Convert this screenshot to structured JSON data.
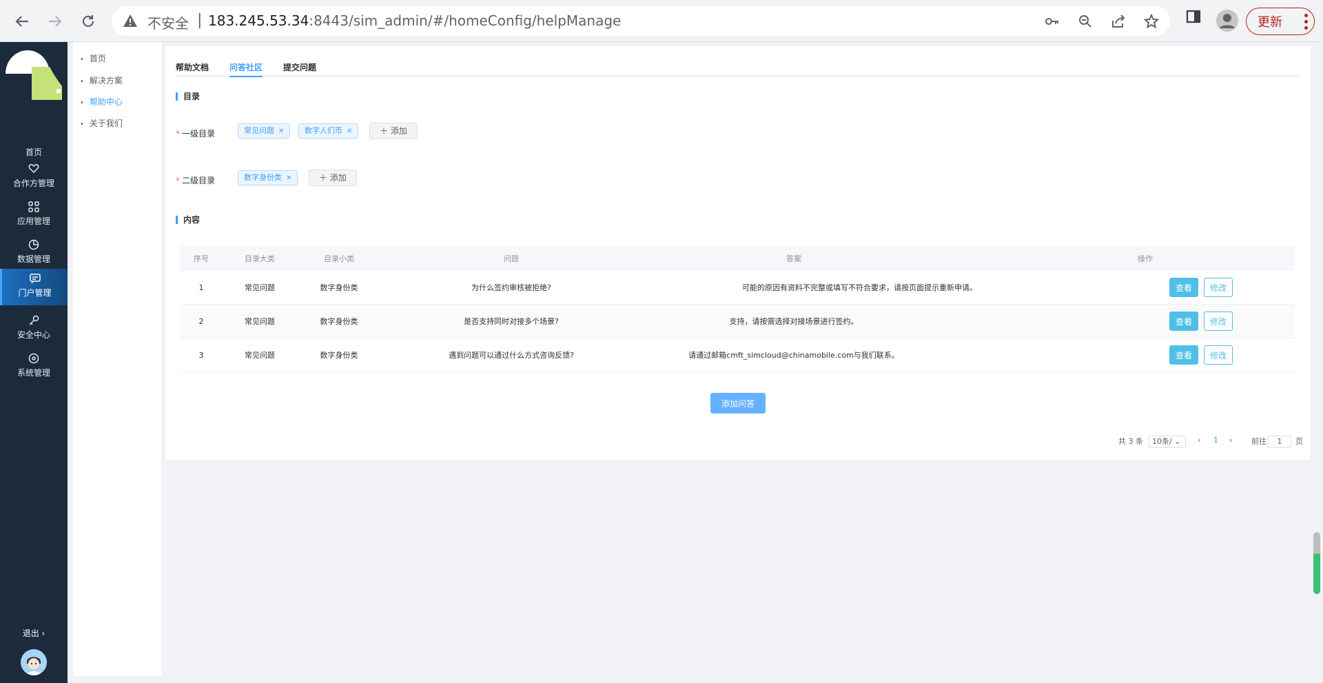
{
  "browser": {
    "insecure_label": "不安全",
    "url_host": "183.245.53.34",
    "url_rest": ":8443/sim_admin/#/homeConfig/helpManage",
    "update_label": "更新"
  },
  "sidebar": {
    "items": [
      {
        "label": "首页",
        "icon": "home-icon"
      },
      {
        "label": "合作方管理",
        "icon": "handshake-icon"
      },
      {
        "label": "应用管理",
        "icon": "grid-icon"
      },
      {
        "label": "数据管理",
        "icon": "pie-chart-icon"
      },
      {
        "label": "门户管理",
        "icon": "message-icon"
      },
      {
        "label": "安全中心",
        "icon": "key-icon"
      },
      {
        "label": "系统管理",
        "icon": "settings-icon"
      }
    ],
    "logout": "退出 ›"
  },
  "subnav": {
    "items": [
      "首页",
      "解决方案",
      "帮助中心",
      "关于我们"
    ]
  },
  "tabs": [
    "帮助文档",
    "问答社区",
    "提交问题"
  ],
  "sections": {
    "catalog": "目录",
    "content": "内容"
  },
  "form": {
    "level1_label": "一级目录",
    "level1_tags": [
      "常见问题",
      "数字人们币"
    ],
    "level2_label": "二级目录",
    "level2_tags": [
      "数字身份类"
    ],
    "add_label": "＋ 添加"
  },
  "table": {
    "headers": [
      "序号",
      "目录大类",
      "目录小类",
      "问题",
      "答案",
      "操作"
    ],
    "rows": [
      {
        "no": "1",
        "cat": "常见问题",
        "sub": "数字身份类",
        "q": "为什么签约审核被拒绝?",
        "a": "可能的原因有资料不完整或填写不符合要求，请按页面提示重新申请。"
      },
      {
        "no": "2",
        "cat": "常见问题",
        "sub": "数字身份类",
        "q": "是否支持同时对接多个场景?",
        "a": "支持，请按需选择对接场景进行签约。"
      },
      {
        "no": "3",
        "cat": "常见问题",
        "sub": "数字身份类",
        "q": "遇到问题可以通过什么方式咨询反馈?",
        "a": "请通过邮箱cmft_simcloud@chinamobile.com与我们联系。"
      }
    ],
    "view_label": "查看",
    "edit_label": "修改"
  },
  "add_qa_label": "添加问答",
  "pagination": {
    "total": "共 3 条",
    "page_size": "10条/",
    "current": "1",
    "goto": "前往",
    "goto_value": "1",
    "page_suffix": "页"
  }
}
